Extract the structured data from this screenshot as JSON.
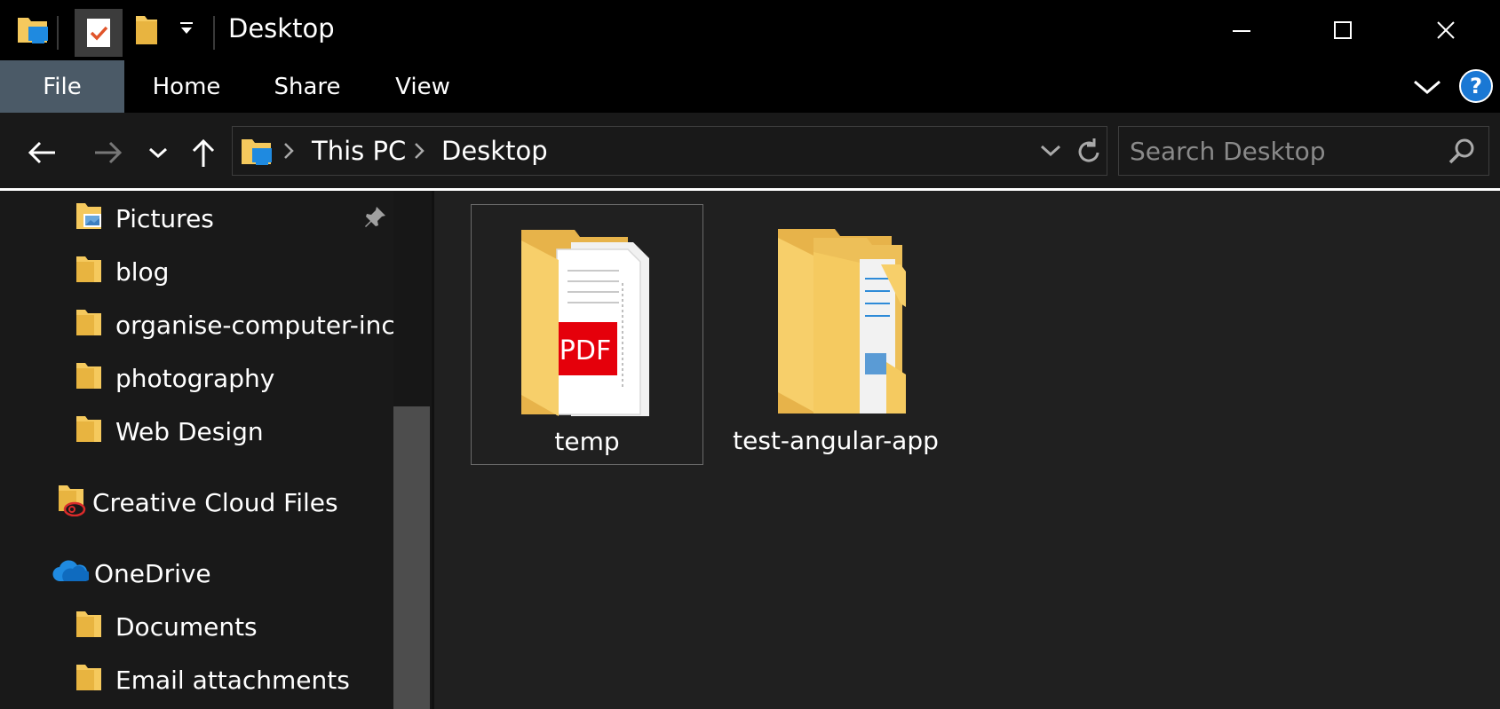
{
  "window": {
    "title": "Desktop",
    "controls": {
      "minimize": "—",
      "maximize": "☐",
      "close": "✕"
    }
  },
  "ribbon": {
    "tabs": [
      "File",
      "Home",
      "Share",
      "View"
    ],
    "help_label": "?"
  },
  "address": {
    "breadcrumbs": [
      "This PC",
      "Desktop"
    ]
  },
  "search": {
    "placeholder": "Search Desktop"
  },
  "sidebar": {
    "items": [
      {
        "label": "Pictures",
        "icon": "pictures-folder-icon",
        "pinned": true
      },
      {
        "label": "blog",
        "icon": "folder-icon"
      },
      {
        "label": "organise-computer-incr",
        "icon": "folder-icon"
      },
      {
        "label": "photography",
        "icon": "folder-icon"
      },
      {
        "label": "Web Design",
        "icon": "folder-icon"
      },
      {
        "label": "Creative Cloud Files",
        "icon": "creative-cloud-folder-icon"
      },
      {
        "label": "OneDrive",
        "icon": "onedrive-cloud-icon"
      },
      {
        "label": "Documents",
        "icon": "folder-icon"
      },
      {
        "label": "Email attachments",
        "icon": "folder-icon"
      }
    ]
  },
  "files": [
    {
      "name": "temp",
      "icon": "folder-with-pdf-icon",
      "selected": true
    },
    {
      "name": "test-angular-app",
      "icon": "folder-with-documents-icon",
      "selected": false
    }
  ],
  "colors": {
    "file_tab": "#4b5a67",
    "folder_yellow": "#f5c95d",
    "accent_blue": "#1a78d4"
  }
}
